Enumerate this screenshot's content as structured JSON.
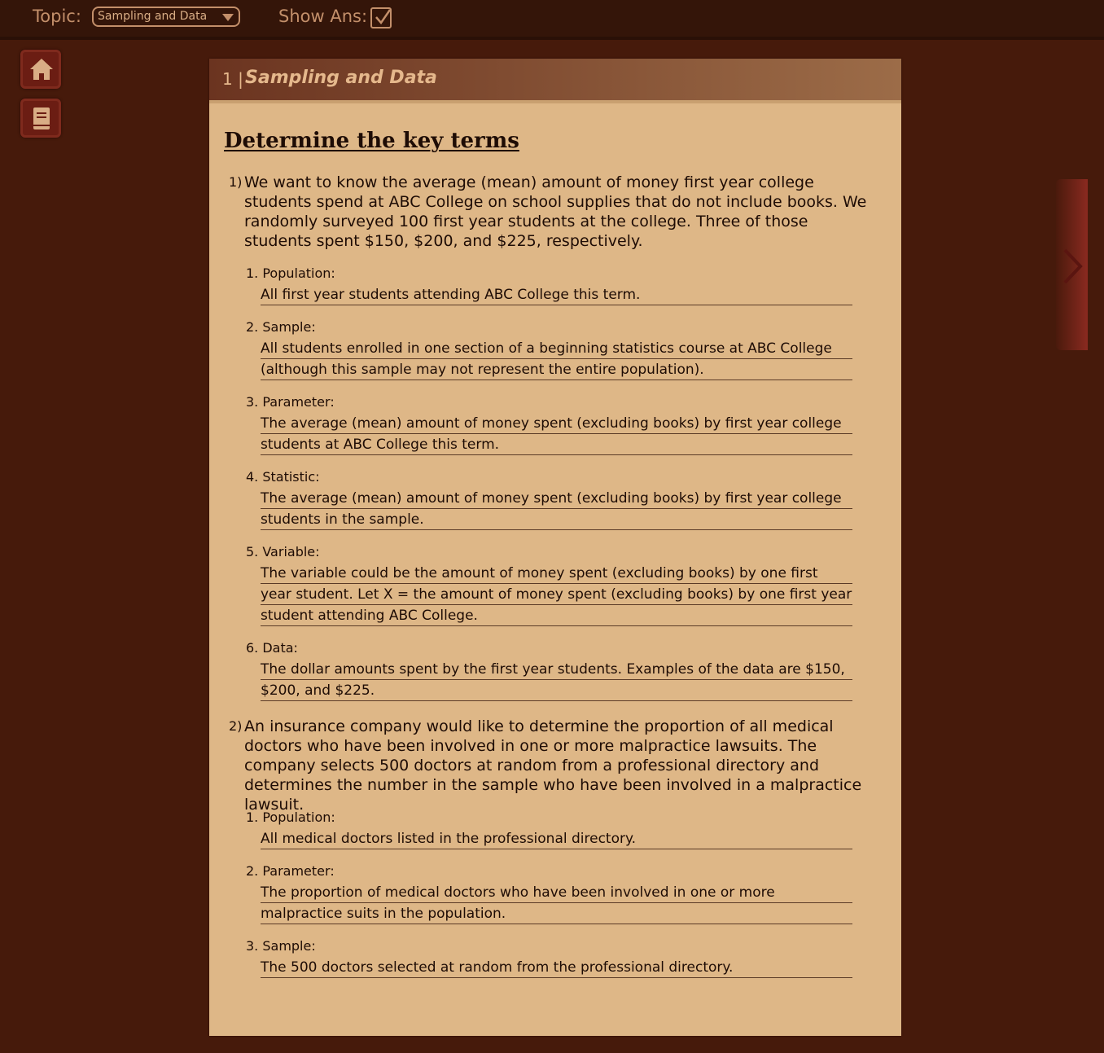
{
  "topbar": {
    "topic_label": "Topic:",
    "topic_value": "Sampling and Data",
    "show_ans_label": "Show Ans:",
    "show_ans_checked": true
  },
  "sidebar": {
    "icons": [
      "home-icon",
      "book-icon"
    ]
  },
  "navigation": {
    "next_icon": "chevron-right-icon"
  },
  "card": {
    "number": "1 |",
    "title": "Sampling and Data",
    "section_title": "Determine the key terms",
    "questions": [
      {
        "num": "1)",
        "text": "We want to know the average (mean) amount of money first year college students spend at ABC College on school supplies that do not include books. We randomly surveyed 100 first year students at the college. Three of those students spent $150, $200, and $225, respectively.",
        "items": [
          {
            "label": "1. Population:",
            "answer": "All first year students attending ABC College this term."
          },
          {
            "label": "2. Sample:",
            "answer": "All students enrolled in one section of a beginning statistics course at ABC College (although this sample may not represent the entire population)."
          },
          {
            "label": "3. Parameter:",
            "answer": "The average (mean) amount of money spent (excluding books) by first year college students at ABC College this term."
          },
          {
            "label": "4. Statistic:",
            "answer": "The average (mean) amount of money spent (excluding books) by first year college students in the sample."
          },
          {
            "label": "5. Variable:",
            "answer": "The variable could be the amount of money spent (excluding books) by one first year student. Let X = the amount of money spent (excluding books) by one first year student attending ABC College."
          },
          {
            "label": "6. Data:",
            "answer": "The dollar amounts spent by the first year students. Examples of the data are $150, $200, and $225."
          }
        ]
      },
      {
        "num": "2)",
        "text": "An insurance company would like to determine the proportion of all medical doctors who have been involved in one or more malpractice lawsuits. The company selects 500 doctors at random from a professional directory and determines the number in the sample who have been involved in a malpractice lawsuit.",
        "items": [
          {
            "label": "1. Population:",
            "answer": "All medical doctors listed in the professional directory."
          },
          {
            "label": "2. Parameter:",
            "answer": "The proportion of medical doctors who have been involved in one or more malpractice suits in the population."
          },
          {
            "label": "3. Sample:",
            "answer": "The 500 doctors selected at random from the professional directory."
          }
        ]
      }
    ]
  },
  "colors": {
    "background": "#461a0b",
    "topbar": "#341509",
    "card": "#deb787",
    "accent": "#c38f6a"
  }
}
